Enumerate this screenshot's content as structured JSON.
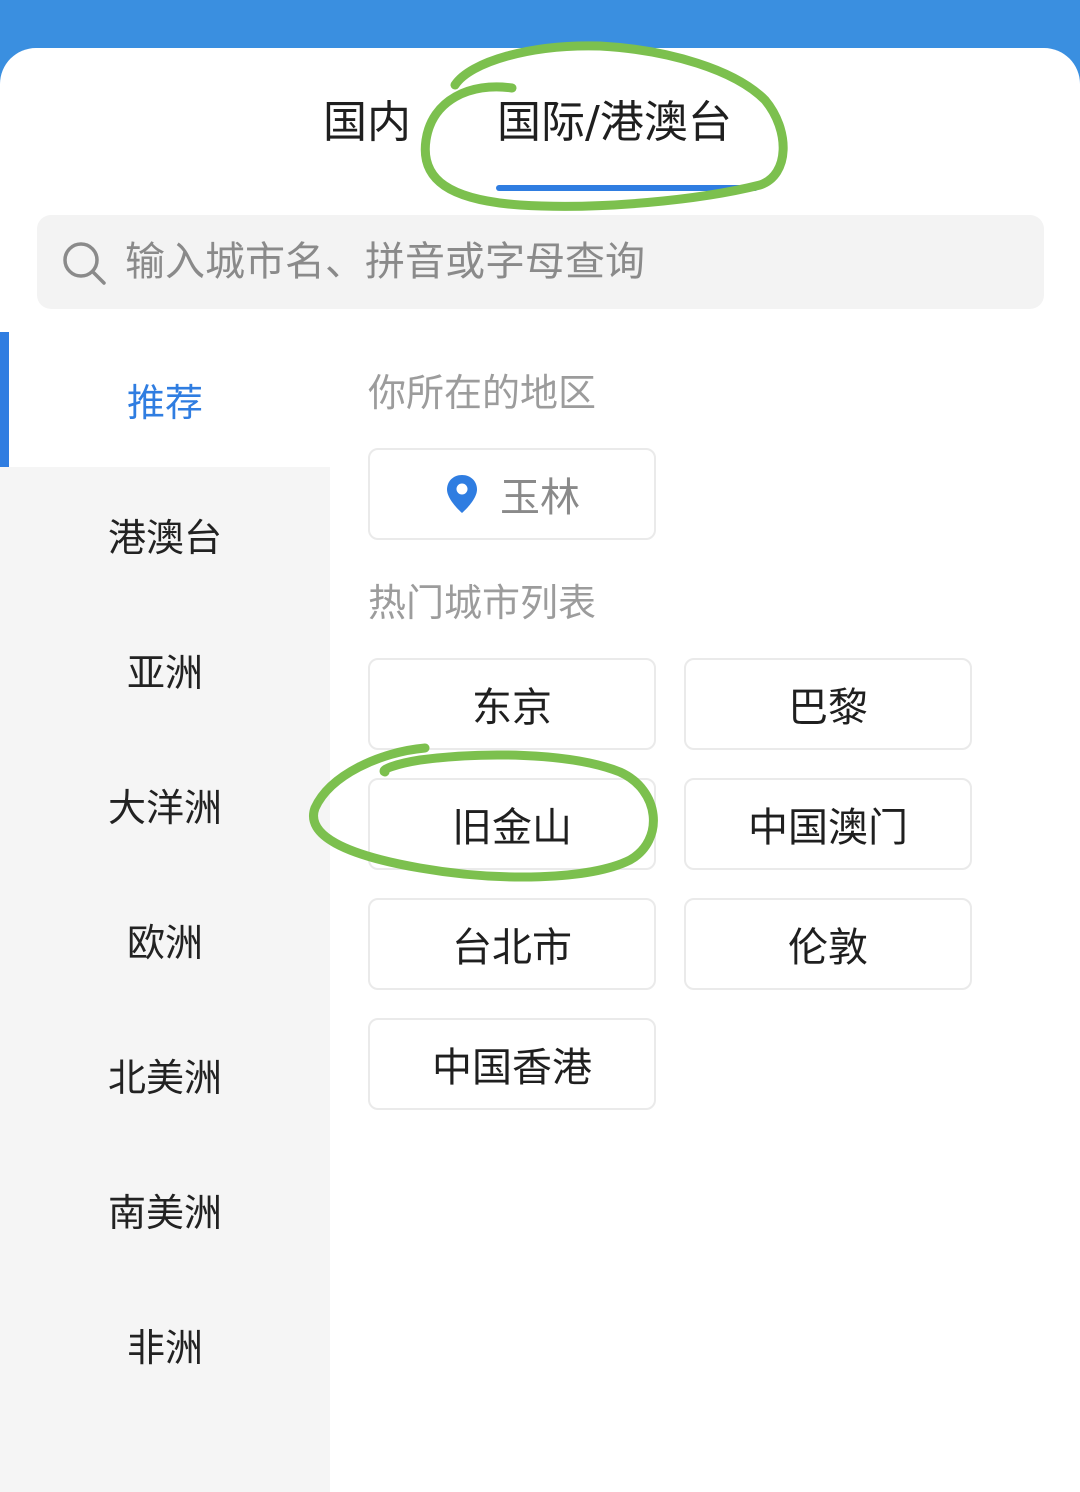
{
  "tabs": {
    "domestic": "国内",
    "international": "国际/港澳台"
  },
  "search": {
    "placeholder": "输入城市名、拼音或字母查询"
  },
  "sidebar": {
    "items": [
      {
        "label": "推荐",
        "active": true
      },
      {
        "label": "港澳台"
      },
      {
        "label": "亚洲"
      },
      {
        "label": "大洋洲"
      },
      {
        "label": "欧洲"
      },
      {
        "label": "北美洲"
      },
      {
        "label": "南美洲"
      },
      {
        "label": "非洲"
      }
    ]
  },
  "location": {
    "title": "你所在的地区",
    "city": "玉林"
  },
  "hot": {
    "title": "热门城市列表",
    "cities": [
      "东京",
      "巴黎",
      "旧金山",
      "中国澳门",
      "台北市",
      "伦敦",
      "中国香港"
    ]
  },
  "colors": {
    "accent": "#2f7de1",
    "header": "#3a8fe0",
    "annotation": "#7cc04e"
  },
  "icons": {
    "search": "search-icon",
    "location": "location-pin-icon"
  }
}
